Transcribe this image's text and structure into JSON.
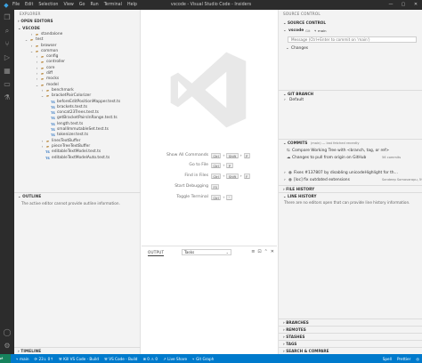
{
  "titlebar": {
    "window_title": "vscode - Visual Studio Code - Insiders",
    "menu": [
      "File",
      "Edit",
      "Selection",
      "View",
      "Go",
      "Run",
      "Terminal",
      "Help"
    ],
    "controls": [
      "—",
      "▢",
      "✕"
    ]
  },
  "activity_bar": {
    "items": [
      "explorer-icon",
      "search-icon",
      "source-control-icon",
      "run-debug-icon",
      "extensions-icon",
      "remote-explorer-icon",
      "testing-icon"
    ],
    "bottom": [
      "accounts-icon",
      "manage-gear-icon"
    ]
  },
  "explorer": {
    "title": "EXPLORER",
    "open_editors": "OPEN EDITORS",
    "root": "VSCODE",
    "tree": [
      {
        "label": "standalone",
        "type": "folder",
        "depth": 3,
        "expanded": false
      },
      {
        "label": "test",
        "type": "folder",
        "depth": 2,
        "expanded": true
      },
      {
        "label": "browser",
        "type": "folder",
        "depth": 3,
        "expanded": false
      },
      {
        "label": "common",
        "type": "folder",
        "depth": 3,
        "expanded": true
      },
      {
        "label": "config",
        "type": "folder",
        "depth": 4,
        "expanded": false
      },
      {
        "label": "controller",
        "type": "folder",
        "depth": 4,
        "expanded": false
      },
      {
        "label": "core",
        "type": "folder",
        "depth": 4,
        "expanded": false
      },
      {
        "label": "diff",
        "type": "folder",
        "depth": 4,
        "expanded": false
      },
      {
        "label": "mocks",
        "type": "folder",
        "depth": 4,
        "expanded": false
      },
      {
        "label": "model",
        "type": "folder",
        "depth": 4,
        "expanded": true
      },
      {
        "label": "benchmark",
        "type": "folder",
        "depth": 5,
        "expanded": false
      },
      {
        "label": "bracketPairColorizer",
        "type": "folder",
        "depth": 5,
        "expanded": true
      },
      {
        "label": "beforeEditPositionMapper.test.ts",
        "type": "ts",
        "depth": 6
      },
      {
        "label": "brackets.test.ts",
        "type": "ts",
        "depth": 6
      },
      {
        "label": "concat23Trees.test.ts",
        "type": "ts",
        "depth": 6
      },
      {
        "label": "getBracketPairsInRange.test.ts",
        "type": "ts",
        "depth": 6
      },
      {
        "label": "length.test.ts",
        "type": "ts",
        "depth": 6
      },
      {
        "label": "smallImmutableSet.test.ts",
        "type": "ts",
        "depth": 6
      },
      {
        "label": "tokenizer.test.ts",
        "type": "ts",
        "depth": 6
      },
      {
        "label": "linesTextBuffer",
        "type": "folder",
        "depth": 5,
        "expanded": false
      },
      {
        "label": "pieceTreeTextBuffer",
        "type": "folder",
        "depth": 5,
        "expanded": false
      },
      {
        "label": "editableTextModel.test.ts",
        "type": "ts",
        "depth": 5
      },
      {
        "label": "editableTextModelAuto.test.ts",
        "type": "ts",
        "depth": 5
      }
    ],
    "outline_title": "OUTLINE",
    "outline_message": "The active editor cannot provide outline information.",
    "timeline_title": "TIMELINE"
  },
  "editor": {
    "hints": [
      {
        "label": "Show All Commands",
        "keys": [
          "Ctrl",
          "Shift",
          "P"
        ]
      },
      {
        "label": "Go to File",
        "keys": [
          "Ctrl",
          "P"
        ]
      },
      {
        "label": "Find in Files",
        "keys": [
          "Ctrl",
          "Shift",
          "F"
        ]
      },
      {
        "label": "Start Debugging",
        "keys": [
          "F5"
        ]
      },
      {
        "label": "Toggle Terminal",
        "keys": [
          "Ctrl",
          "`"
        ]
      }
    ]
  },
  "panel": {
    "tab": "OUTPUT",
    "select_value": "Tasks"
  },
  "source_control": {
    "title": "SOURCE CONTROL",
    "section": "SOURCE CONTROL",
    "repo_name": "vscode",
    "repo_kind": "Git",
    "branch": "main",
    "commit_placeholder": "Message (Ctrl+Enter to commit on 'main')",
    "changes_label": "Changes",
    "git_branch_title": "GIT BRANCH",
    "git_branch_item": "Default",
    "commits_title": "COMMITS",
    "commits_meta": "(main) — last fetched recently",
    "commits": [
      {
        "icon": "compare-icon",
        "text": "Compare Working Tree with <branch, tag, or ref>",
        "meta": ""
      },
      {
        "icon": "cloud-download-icon",
        "text": "Changes to pull from origin on GitHub",
        "meta": "56 commits"
      },
      {
        "icon": "commit-icon",
        "text": "Fixes #137807 by disabling unicodeHighlight for the output pane...",
        "meta": ""
      },
      {
        "icon": "commit-icon",
        "text": "[loc] fix outdated extensions",
        "meta": "Sandeep Somavarapu, 59 minutes ago"
      },
      {
        "icon": "commit-icon",
        "text": "Ensure problem matchers are properly rerun",
        "meta": ""
      }
    ],
    "file_history_title": "FILE HISTORY",
    "line_history_title": "LINE HISTORY",
    "line_history_message": "There are no editors open that can provide line history information.",
    "bottom_sections": [
      "BRANCHES",
      "REMOTES",
      "STASHES",
      "TAGS",
      "SEARCH & COMPARE"
    ]
  },
  "statusbar": {
    "branch": "main",
    "sync": "23↓ 0↑",
    "items": [
      "Kill VS Code - Build",
      "VS Code - Build"
    ],
    "problems": "⊗ 0 ⚠ 0",
    "live_share": "Live Share",
    "git_graph": "Git Graph",
    "right": [
      "Spell",
      "Prettier",
      "◎"
    ]
  },
  "colors": {
    "titlebar_bg": "#2c2c2c",
    "sidebar_bg": "#f3f3f3",
    "statusbar_bg": "#007acc",
    "remote_bg": "#16825d",
    "folder": "#c09553",
    "ts": "#2f74c0"
  }
}
